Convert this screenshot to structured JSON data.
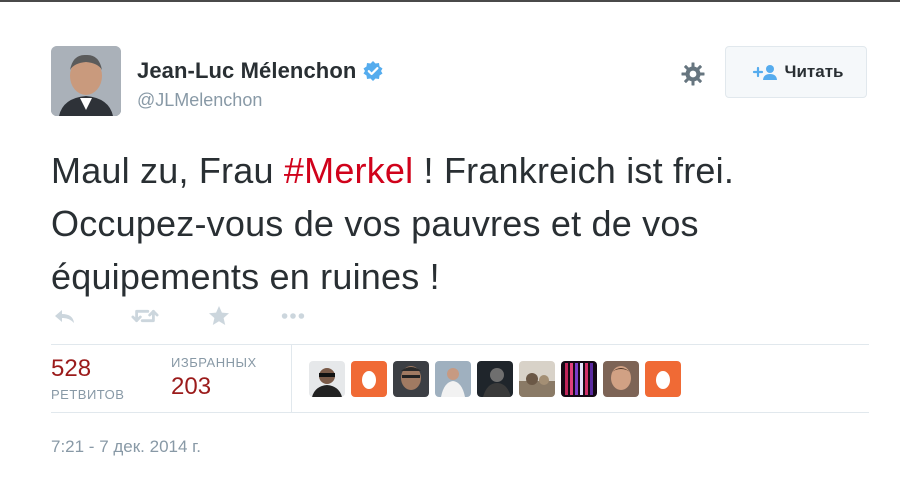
{
  "user": {
    "name": "Jean-Luc Mélenchon",
    "handle": "@JLMelenchon"
  },
  "follow_button": {
    "label": "Читать"
  },
  "tweet": {
    "before": "Maul zu, Frau ",
    "hashtag_symbol": "#",
    "hashtag": "Merkel",
    "after": " ! Frankreich ist frei. Occupez-vous de vos pauvres et de vos équipements en ruines !"
  },
  "stats": {
    "retweets_count": "528",
    "retweets_label": "РЕТВИТОВ",
    "favorites_label": "ИЗБРАННЫХ",
    "favorites_count": "203"
  },
  "timestamp": "7:21 - 7 дек. 2014 г.",
  "icons": {
    "verified": "verified-badge-icon",
    "gear": "gear-icon",
    "follow": "add-user-icon",
    "reply": "reply-icon",
    "retweet": "retweet-icon",
    "favorite": "star-icon",
    "more": "more-dots-icon"
  },
  "colors": {
    "hashtag": "#d0021b",
    "stat_value": "#9b1b1b",
    "verified": "#55acee",
    "egg": "#f06a35"
  }
}
